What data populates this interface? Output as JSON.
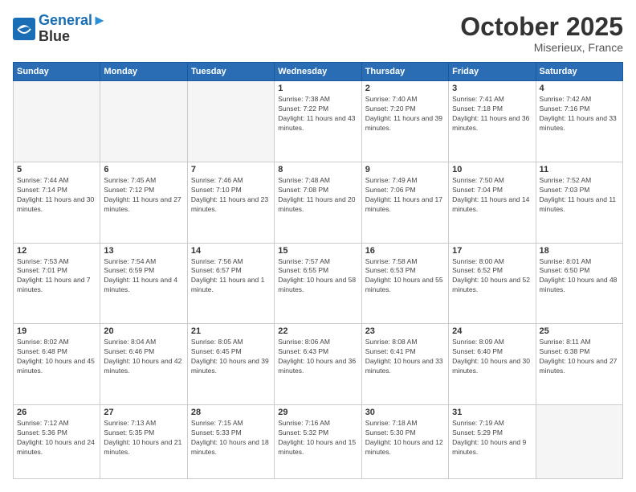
{
  "header": {
    "logo_line1": "General",
    "logo_line2": "Blue",
    "month": "October 2025",
    "location": "Miserieux, France"
  },
  "weekdays": [
    "Sunday",
    "Monday",
    "Tuesday",
    "Wednesday",
    "Thursday",
    "Friday",
    "Saturday"
  ],
  "weeks": [
    [
      {
        "day": "",
        "info": ""
      },
      {
        "day": "",
        "info": ""
      },
      {
        "day": "",
        "info": ""
      },
      {
        "day": "1",
        "info": "Sunrise: 7:38 AM\nSunset: 7:22 PM\nDaylight: 11 hours and 43 minutes."
      },
      {
        "day": "2",
        "info": "Sunrise: 7:40 AM\nSunset: 7:20 PM\nDaylight: 11 hours and 39 minutes."
      },
      {
        "day": "3",
        "info": "Sunrise: 7:41 AM\nSunset: 7:18 PM\nDaylight: 11 hours and 36 minutes."
      },
      {
        "day": "4",
        "info": "Sunrise: 7:42 AM\nSunset: 7:16 PM\nDaylight: 11 hours and 33 minutes."
      }
    ],
    [
      {
        "day": "5",
        "info": "Sunrise: 7:44 AM\nSunset: 7:14 PM\nDaylight: 11 hours and 30 minutes."
      },
      {
        "day": "6",
        "info": "Sunrise: 7:45 AM\nSunset: 7:12 PM\nDaylight: 11 hours and 27 minutes."
      },
      {
        "day": "7",
        "info": "Sunrise: 7:46 AM\nSunset: 7:10 PM\nDaylight: 11 hours and 23 minutes."
      },
      {
        "day": "8",
        "info": "Sunrise: 7:48 AM\nSunset: 7:08 PM\nDaylight: 11 hours and 20 minutes."
      },
      {
        "day": "9",
        "info": "Sunrise: 7:49 AM\nSunset: 7:06 PM\nDaylight: 11 hours and 17 minutes."
      },
      {
        "day": "10",
        "info": "Sunrise: 7:50 AM\nSunset: 7:04 PM\nDaylight: 11 hours and 14 minutes."
      },
      {
        "day": "11",
        "info": "Sunrise: 7:52 AM\nSunset: 7:03 PM\nDaylight: 11 hours and 11 minutes."
      }
    ],
    [
      {
        "day": "12",
        "info": "Sunrise: 7:53 AM\nSunset: 7:01 PM\nDaylight: 11 hours and 7 minutes."
      },
      {
        "day": "13",
        "info": "Sunrise: 7:54 AM\nSunset: 6:59 PM\nDaylight: 11 hours and 4 minutes."
      },
      {
        "day": "14",
        "info": "Sunrise: 7:56 AM\nSunset: 6:57 PM\nDaylight: 11 hours and 1 minute."
      },
      {
        "day": "15",
        "info": "Sunrise: 7:57 AM\nSunset: 6:55 PM\nDaylight: 10 hours and 58 minutes."
      },
      {
        "day": "16",
        "info": "Sunrise: 7:58 AM\nSunset: 6:53 PM\nDaylight: 10 hours and 55 minutes."
      },
      {
        "day": "17",
        "info": "Sunrise: 8:00 AM\nSunset: 6:52 PM\nDaylight: 10 hours and 52 minutes."
      },
      {
        "day": "18",
        "info": "Sunrise: 8:01 AM\nSunset: 6:50 PM\nDaylight: 10 hours and 48 minutes."
      }
    ],
    [
      {
        "day": "19",
        "info": "Sunrise: 8:02 AM\nSunset: 6:48 PM\nDaylight: 10 hours and 45 minutes."
      },
      {
        "day": "20",
        "info": "Sunrise: 8:04 AM\nSunset: 6:46 PM\nDaylight: 10 hours and 42 minutes."
      },
      {
        "day": "21",
        "info": "Sunrise: 8:05 AM\nSunset: 6:45 PM\nDaylight: 10 hours and 39 minutes."
      },
      {
        "day": "22",
        "info": "Sunrise: 8:06 AM\nSunset: 6:43 PM\nDaylight: 10 hours and 36 minutes."
      },
      {
        "day": "23",
        "info": "Sunrise: 8:08 AM\nSunset: 6:41 PM\nDaylight: 10 hours and 33 minutes."
      },
      {
        "day": "24",
        "info": "Sunrise: 8:09 AM\nSunset: 6:40 PM\nDaylight: 10 hours and 30 minutes."
      },
      {
        "day": "25",
        "info": "Sunrise: 8:11 AM\nSunset: 6:38 PM\nDaylight: 10 hours and 27 minutes."
      }
    ],
    [
      {
        "day": "26",
        "info": "Sunrise: 7:12 AM\nSunset: 5:36 PM\nDaylight: 10 hours and 24 minutes."
      },
      {
        "day": "27",
        "info": "Sunrise: 7:13 AM\nSunset: 5:35 PM\nDaylight: 10 hours and 21 minutes."
      },
      {
        "day": "28",
        "info": "Sunrise: 7:15 AM\nSunset: 5:33 PM\nDaylight: 10 hours and 18 minutes."
      },
      {
        "day": "29",
        "info": "Sunrise: 7:16 AM\nSunset: 5:32 PM\nDaylight: 10 hours and 15 minutes."
      },
      {
        "day": "30",
        "info": "Sunrise: 7:18 AM\nSunset: 5:30 PM\nDaylight: 10 hours and 12 minutes."
      },
      {
        "day": "31",
        "info": "Sunrise: 7:19 AM\nSunset: 5:29 PM\nDaylight: 10 hours and 9 minutes."
      },
      {
        "day": "",
        "info": ""
      }
    ]
  ]
}
